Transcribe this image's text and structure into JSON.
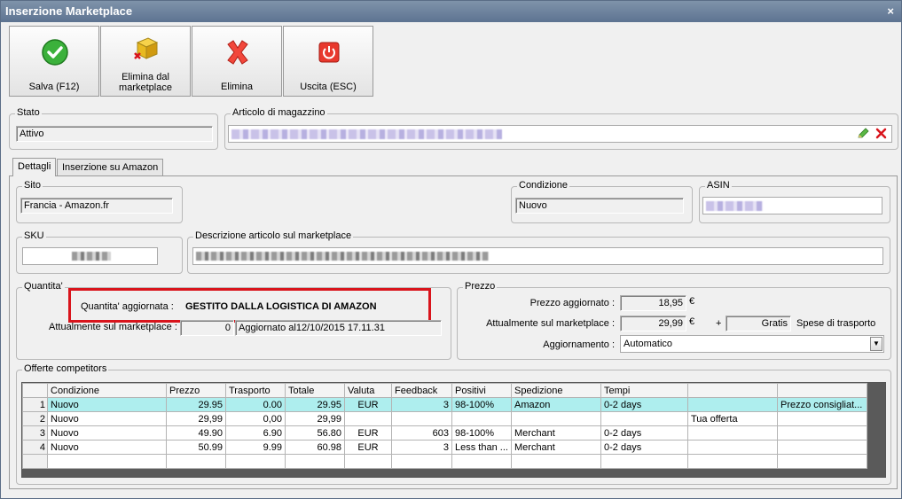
{
  "window": {
    "title": "Inserzione Marketplace",
    "close_glyph": "×"
  },
  "toolbar": {
    "save_label": "Salva (F12)",
    "remove_marketplace_label_1": "Elimina dal",
    "remove_marketplace_label_2": "marketplace",
    "delete_label": "Elimina",
    "exit_label": "Uscita (ESC)"
  },
  "stato": {
    "title": "Stato",
    "value": "Attivo"
  },
  "articolo": {
    "title": "Articolo di magazzino"
  },
  "tabs": [
    {
      "label": "Dettagli",
      "active": true
    },
    {
      "label": "Inserzione su Amazon",
      "active": false
    }
  ],
  "sito": {
    "title": "Sito",
    "value": "Francia - Amazon.fr"
  },
  "condizione": {
    "title": "Condizione",
    "value": "Nuovo"
  },
  "asin": {
    "title": "ASIN"
  },
  "sku": {
    "title": "SKU"
  },
  "descrizione": {
    "title": "Descrizione articolo sul marketplace"
  },
  "quantita": {
    "title": "Quantita'",
    "updated_label": "Quantita' aggiornata :",
    "updated_value": "GESTITO DALLA LOGISTICA DI AMAZON",
    "current_label": "Attualmente sul marketplace :",
    "current_value": "0",
    "updated_at": "Aggiornato al12/10/2015 17.11.31"
  },
  "prezzo": {
    "title": "Prezzo",
    "updated_label": "Prezzo aggiornato :",
    "updated_value": "18,95",
    "current_label": "Attualmente sul marketplace :",
    "current_value": "29,99",
    "currency": "€",
    "plus": "+",
    "shipping_value": "Gratis",
    "shipping_label": "Spese di trasporto",
    "aggiornamento_label": "Aggiornamento :",
    "aggiornamento_value": "Automatico"
  },
  "offerte": {
    "title": "Offerte competitors",
    "columns": [
      "Condizione",
      "Prezzo",
      "Trasporto",
      "Totale",
      "Valuta",
      "Feedback",
      "Positivi",
      "Spedizione",
      "Tempi",
      "",
      ""
    ],
    "rows": [
      {
        "idx": "1",
        "cells": [
          "Nuovo",
          "29.95",
          "0.00",
          "29.95",
          "EUR",
          "3",
          "98-100%",
          "Amazon",
          "0-2 days",
          "",
          "Prezzo consigliat..."
        ]
      },
      {
        "idx": "2",
        "cells": [
          "Nuovo",
          "29,99",
          "0,00",
          "29,99",
          "",
          "",
          "",
          "",
          "",
          "Tua offerta",
          ""
        ]
      },
      {
        "idx": "3",
        "cells": [
          "Nuovo",
          "49.90",
          "6.90",
          "56.80",
          "EUR",
          "603",
          "98-100%",
          "Merchant",
          "0-2 days",
          "",
          ""
        ]
      },
      {
        "idx": "4",
        "cells": [
          "Nuovo",
          "50.99",
          "9.99",
          "60.98",
          "EUR",
          "3",
          "Less than ...",
          "Merchant",
          "0-2 days",
          "",
          ""
        ]
      },
      {
        "idx": "",
        "cells": [
          "",
          "",
          "",
          "",
          "",
          "",
          "",
          "",
          "",
          "",
          ""
        ]
      }
    ]
  },
  "colors": {
    "titlebar": "#6a7f9b",
    "selected_row": "#aeeeee",
    "highlight_border": "#d9141c"
  }
}
